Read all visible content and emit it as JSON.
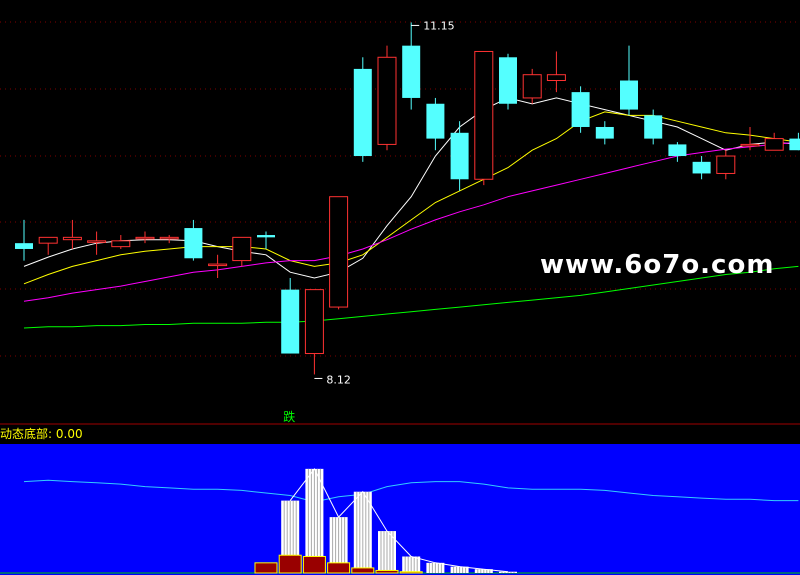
{
  "watermark": "www.6o7o.com",
  "indicator": {
    "name": "动态底部:",
    "value": "0.00"
  },
  "colors": {
    "up": "#ff3232",
    "down": "#54ffff",
    "ma5": "#ffffff",
    "ma10": "#ffff00",
    "ma20": "#ff00ff",
    "ma60": "#00ff00",
    "grid": "#800000",
    "sub_bg": "#0000ff"
  },
  "chart_data": [
    {
      "type": "candlestick",
      "title": "",
      "ylim": [
        7.9,
        11.3
      ],
      "annotations": [
        {
          "text": "11.15",
          "candle": 16,
          "kind": "high"
        },
        {
          "text": "8.12",
          "candle": 12,
          "kind": "low"
        },
        {
          "text": "跌",
          "candle": 11,
          "kind": "signal"
        }
      ],
      "candles": [
        {
          "o": 9.25,
          "h": 9.45,
          "l": 9.1,
          "c": 9.2
        },
        {
          "o": 9.25,
          "h": 9.3,
          "l": 9.15,
          "c": 9.3
        },
        {
          "o": 9.28,
          "h": 9.45,
          "l": 9.2,
          "c": 9.3
        },
        {
          "o": 9.27,
          "h": 9.35,
          "l": 9.15,
          "c": 9.27
        },
        {
          "o": 9.22,
          "h": 9.32,
          "l": 9.2,
          "c": 9.27
        },
        {
          "o": 9.3,
          "h": 9.35,
          "l": 9.25,
          "c": 9.3
        },
        {
          "o": 9.3,
          "h": 9.32,
          "l": 9.25,
          "c": 9.3
        },
        {
          "o": 9.38,
          "h": 9.45,
          "l": 9.1,
          "c": 9.12
        },
        {
          "o": 9.07,
          "h": 9.15,
          "l": 8.95,
          "c": 9.07
        },
        {
          "o": 9.1,
          "h": 9.3,
          "l": 9.05,
          "c": 9.3
        },
        {
          "o": 9.32,
          "h": 9.35,
          "l": 9.2,
          "c": 9.3
        },
        {
          "o": 8.85,
          "h": 8.95,
          "l": 8.3,
          "c": 8.3
        },
        {
          "o": 8.3,
          "h": 8.85,
          "l": 8.12,
          "c": 8.85
        },
        {
          "o": 8.7,
          "h": 9.65,
          "l": 8.68,
          "c": 9.65
        },
        {
          "o": 10.75,
          "h": 10.85,
          "l": 9.95,
          "c": 10.0
        },
        {
          "o": 10.1,
          "h": 10.95,
          "l": 10.05,
          "c": 10.85
        },
        {
          "o": 10.95,
          "h": 11.15,
          "l": 10.4,
          "c": 10.5
        },
        {
          "o": 10.45,
          "h": 10.5,
          "l": 10.05,
          "c": 10.15
        },
        {
          "o": 10.2,
          "h": 10.3,
          "l": 9.7,
          "c": 9.8
        },
        {
          "o": 9.8,
          "h": 10.9,
          "l": 9.75,
          "c": 10.9
        },
        {
          "o": 10.85,
          "h": 10.88,
          "l": 10.4,
          "c": 10.45
        },
        {
          "o": 10.5,
          "h": 10.75,
          "l": 10.45,
          "c": 10.7
        },
        {
          "o": 10.65,
          "h": 10.9,
          "l": 10.55,
          "c": 10.7
        },
        {
          "o": 10.55,
          "h": 10.6,
          "l": 10.2,
          "c": 10.25
        },
        {
          "o": 10.25,
          "h": 10.3,
          "l": 10.1,
          "c": 10.15
        },
        {
          "o": 10.65,
          "h": 10.95,
          "l": 10.35,
          "c": 10.4
        },
        {
          "o": 10.35,
          "h": 10.4,
          "l": 10.1,
          "c": 10.15
        },
        {
          "o": 10.1,
          "h": 10.12,
          "l": 9.95,
          "c": 10.0
        },
        {
          "o": 9.95,
          "h": 10.0,
          "l": 9.8,
          "c": 9.85
        },
        {
          "o": 9.85,
          "h": 10.05,
          "l": 9.8,
          "c": 10.0
        },
        {
          "o": 10.1,
          "h": 10.25,
          "l": 10.05,
          "c": 10.1
        },
        {
          "o": 10.05,
          "h": 10.2,
          "l": 10.05,
          "c": 10.15
        },
        {
          "o": 10.15,
          "h": 10.2,
          "l": 10.05,
          "c": 10.05
        }
      ],
      "series": [
        {
          "name": "MA5",
          "values": [
            9.05,
            9.13,
            9.2,
            9.25,
            9.27,
            9.28,
            9.28,
            9.27,
            9.22,
            9.18,
            9.15,
            9.0,
            8.95,
            9.0,
            9.12,
            9.4,
            9.65,
            10.0,
            10.25,
            10.4,
            10.5,
            10.45,
            10.5,
            10.45,
            10.4,
            10.35,
            10.3,
            10.25,
            10.15,
            10.05,
            10.1,
            10.12,
            10.1
          ]
        },
        {
          "name": "MA10",
          "values": [
            8.9,
            8.98,
            9.05,
            9.1,
            9.15,
            9.18,
            9.2,
            9.22,
            9.22,
            9.22,
            9.2,
            9.1,
            9.05,
            9.08,
            9.15,
            9.3,
            9.45,
            9.6,
            9.7,
            9.8,
            9.9,
            10.05,
            10.15,
            10.3,
            10.38,
            10.35,
            10.35,
            10.3,
            10.25,
            10.2,
            10.18,
            10.15,
            10.12
          ]
        },
        {
          "name": "MA20",
          "values": [
            8.75,
            8.78,
            8.82,
            8.85,
            8.88,
            8.92,
            8.96,
            9.0,
            9.02,
            9.05,
            9.08,
            9.1,
            9.1,
            9.14,
            9.2,
            9.28,
            9.37,
            9.45,
            9.52,
            9.58,
            9.65,
            9.7,
            9.75,
            9.8,
            9.85,
            9.9,
            9.95,
            10.0,
            10.03,
            10.06,
            10.08,
            10.1,
            10.12
          ]
        },
        {
          "name": "MA60",
          "values": [
            8.52,
            8.53,
            8.53,
            8.54,
            8.54,
            8.55,
            8.55,
            8.56,
            8.56,
            8.56,
            8.57,
            8.57,
            8.58,
            8.6,
            8.62,
            8.64,
            8.66,
            8.68,
            8.7,
            8.72,
            8.74,
            8.76,
            8.78,
            8.8,
            8.83,
            8.86,
            8.89,
            8.92,
            8.95,
            8.98,
            9.0,
            9.03,
            9.05
          ]
        }
      ]
    },
    {
      "type": "bar",
      "title": "动态底部",
      "ylim": [
        0,
        100
      ],
      "line": [
        72,
        73,
        72,
        71,
        70,
        68,
        67,
        66,
        66,
        65,
        63,
        61,
        56,
        60,
        62,
        68,
        71,
        72,
        72,
        70,
        67,
        66,
        66,
        66,
        65,
        63,
        61,
        60,
        59,
        58,
        58,
        57,
        57
      ],
      "white_bars": [
        0,
        0,
        0,
        0,
        0,
        0,
        0,
        0,
        0,
        0,
        0,
        57,
        82,
        44,
        64,
        33,
        13,
        8,
        5,
        3,
        1,
        0,
        0,
        0,
        0,
        0,
        0,
        0,
        0,
        0,
        0,
        0,
        0
      ],
      "red_bars": [
        0,
        0,
        0,
        0,
        0,
        0,
        0,
        0,
        0,
        0,
        8,
        14,
        13,
        8,
        4,
        2,
        1,
        0,
        0,
        0,
        0,
        0,
        0,
        0,
        0,
        0,
        0,
        0,
        0,
        0,
        0,
        0,
        0
      ]
    }
  ]
}
